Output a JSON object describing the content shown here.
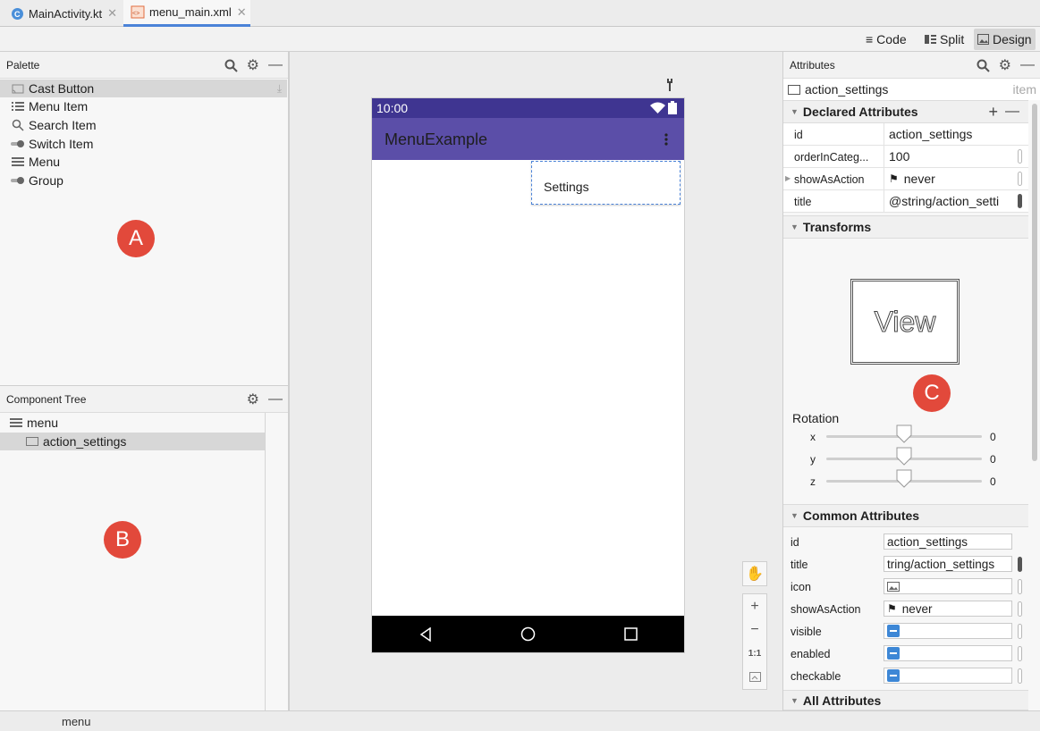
{
  "tabs": [
    {
      "label": "MainActivity.kt",
      "icon": "kotlin-file-icon"
    },
    {
      "label": "menu_main.xml",
      "icon": "xml-file-icon"
    }
  ],
  "view_modes": {
    "code": "Code",
    "split": "Split",
    "design": "Design",
    "selected": "Design"
  },
  "palette": {
    "title": "Palette",
    "items": [
      {
        "label": "Cast Button",
        "icon": "cast-icon"
      },
      {
        "label": "Menu Item",
        "icon": "list-icon"
      },
      {
        "label": "Search Item",
        "icon": "search-icon"
      },
      {
        "label": "Switch Item",
        "icon": "switch-icon"
      },
      {
        "label": "Menu",
        "icon": "menu-icon"
      },
      {
        "label": "Group",
        "icon": "group-icon"
      }
    ],
    "badge": "A"
  },
  "component_tree": {
    "title": "Component Tree",
    "items": [
      {
        "label": "menu",
        "icon": "menu-icon"
      },
      {
        "label": "action_settings",
        "icon": "item-icon"
      }
    ],
    "badge": "B"
  },
  "device": {
    "time": "10:00",
    "app_title": "MenuExample",
    "menu_item": "Settings",
    "colors": {
      "status_bar": "#3f3591",
      "app_bar": "#5b4ea8",
      "nav_bar": "#000000"
    }
  },
  "attributes": {
    "title": "Attributes",
    "component_name": "action_settings",
    "component_type": "item",
    "declared": {
      "title": "Declared Attributes",
      "rows": [
        {
          "key": "id",
          "value": "action_settings"
        },
        {
          "key": "orderInCateg...",
          "value": "100"
        },
        {
          "key": "showAsAction",
          "value": "never"
        },
        {
          "key": "title",
          "value": "@string/action_setti"
        }
      ]
    },
    "transforms": {
      "title": "Transforms",
      "preview": "View",
      "badge": "C",
      "rotation_label": "Rotation",
      "axes": [
        {
          "axis": "x",
          "value": "0",
          "level": 0.5
        },
        {
          "axis": "y",
          "value": "0",
          "level": 0.5
        },
        {
          "axis": "z",
          "value": "0",
          "level": 0.5
        }
      ]
    },
    "common": {
      "title": "Common Attributes",
      "rows": [
        {
          "key": "id",
          "value": "action_settings"
        },
        {
          "key": "title",
          "value": "tring/action_settings"
        },
        {
          "key": "icon",
          "value": ""
        },
        {
          "key": "showAsAction",
          "value": "never"
        },
        {
          "key": "visible",
          "value": ""
        },
        {
          "key": "enabled",
          "value": ""
        },
        {
          "key": "checkable",
          "value": ""
        }
      ]
    },
    "all": {
      "title": "All Attributes"
    }
  },
  "zoom": {
    "one_to_one": "1:1"
  },
  "status_bar": {
    "text": "menu"
  }
}
